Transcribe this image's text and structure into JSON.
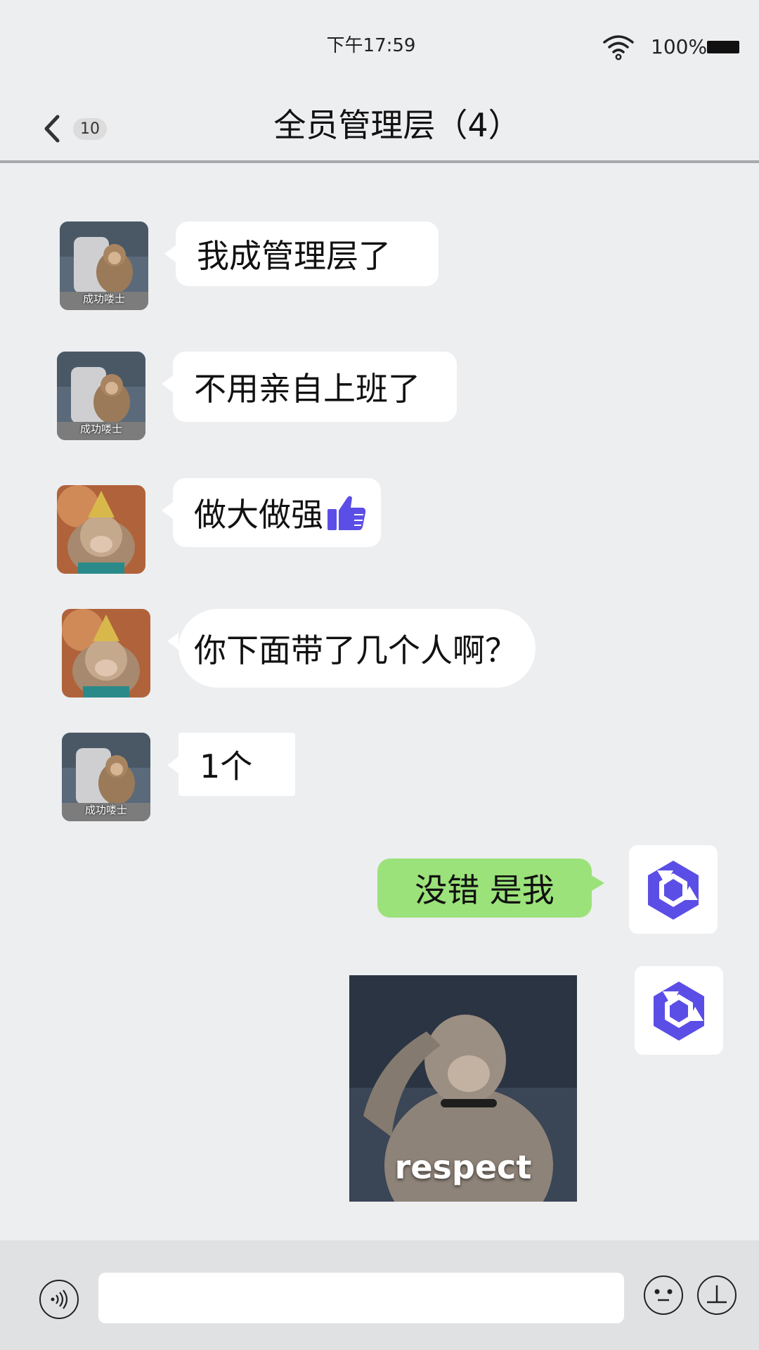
{
  "status_bar": {
    "time": "下午17:59",
    "battery": "100%"
  },
  "header": {
    "unread_count": "10",
    "title": "全员管理层（4）"
  },
  "messages": [
    {
      "text": "我成管理层了",
      "avatar_caption": "成功喽士"
    },
    {
      "text": "不用亲自上班了",
      "avatar_caption": "成功喽士"
    },
    {
      "text": "做大做强",
      "emoji": "thumbs-up-icon"
    },
    {
      "text": "你下面带了几个人啊？"
    },
    {
      "text": "1个",
      "avatar_caption": "成功喽士"
    },
    {
      "text": "没错  是我"
    }
  ],
  "sticker": {
    "caption": "respect"
  },
  "input_bar": {
    "value": ""
  },
  "colors": {
    "background": "#edeef0",
    "my_bubble": "#9be27a",
    "their_bubble": "#ffffff",
    "accent": "#5b4ee6"
  }
}
